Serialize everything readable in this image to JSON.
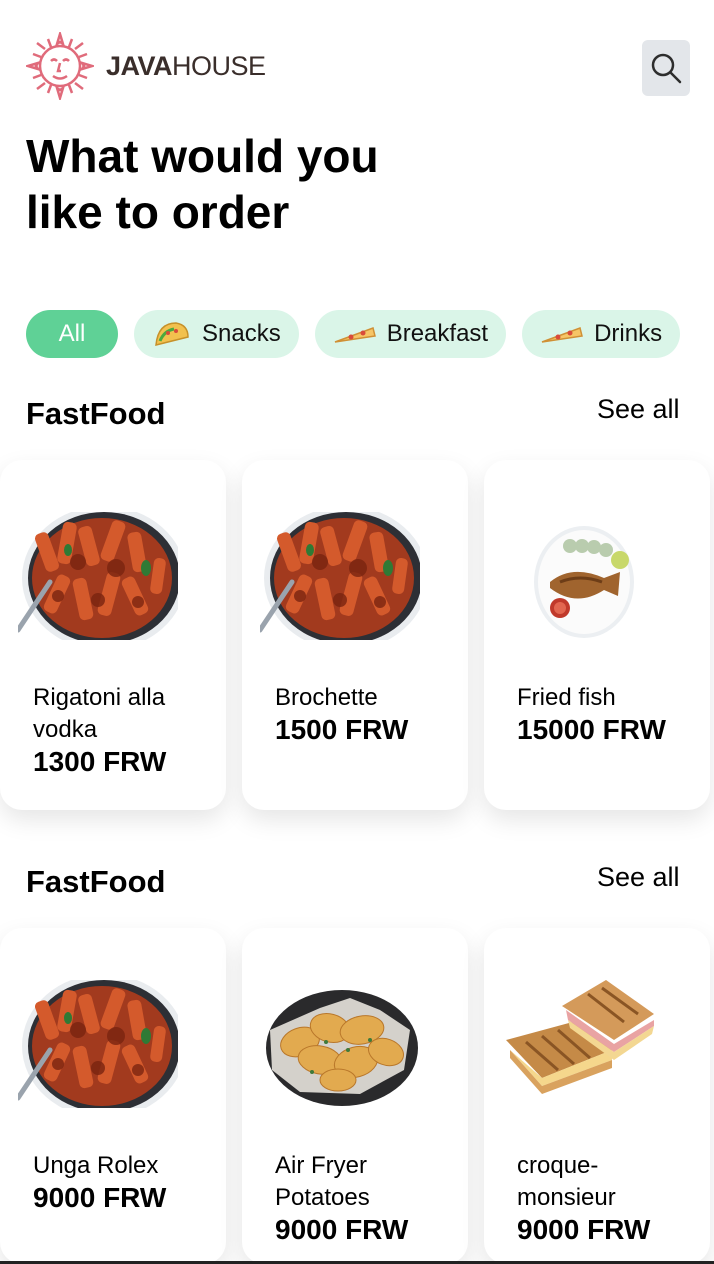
{
  "brand": {
    "name_bold": "JAVA",
    "name_regular": "HOUSE"
  },
  "search": {
    "icon": "search-icon"
  },
  "title": {
    "line1": "What would you",
    "line2": "like to order"
  },
  "categories": [
    {
      "label": "All",
      "active": true
    },
    {
      "label": "Snacks",
      "icon": "taco-icon"
    },
    {
      "label": "Breakfast",
      "icon": "pizza-icon"
    },
    {
      "label": "Drinks",
      "icon": "pizza-icon"
    }
  ],
  "sections": [
    {
      "title": "FastFood",
      "see_all": "See all",
      "items": [
        {
          "name": "Rigatoni alla vodka",
          "price": "1300 FRW",
          "image": "pasta-image"
        },
        {
          "name": "Brochette",
          "price": "1500 FRW",
          "image": "pasta-image"
        },
        {
          "name": "Fried fish",
          "price": "15000 FRW",
          "image": "fried-fish-image"
        }
      ]
    },
    {
      "title": "FastFood",
      "see_all": "See all",
      "items": [
        {
          "name": "Unga Rolex",
          "price": "9000 FRW",
          "image": "pasta-image"
        },
        {
          "name": "Air Fryer Potatoes",
          "price": "9000 FRW",
          "image": "potato-chips-image"
        },
        {
          "name": "croque-monsieur",
          "price": "9000 FRW",
          "image": "sandwich-image"
        }
      ]
    }
  ],
  "colors": {
    "accent": "#5fd196",
    "chip_bg": "#daf5e8",
    "search_bg": "#e3e6ea",
    "logo": "#e06b7b"
  }
}
